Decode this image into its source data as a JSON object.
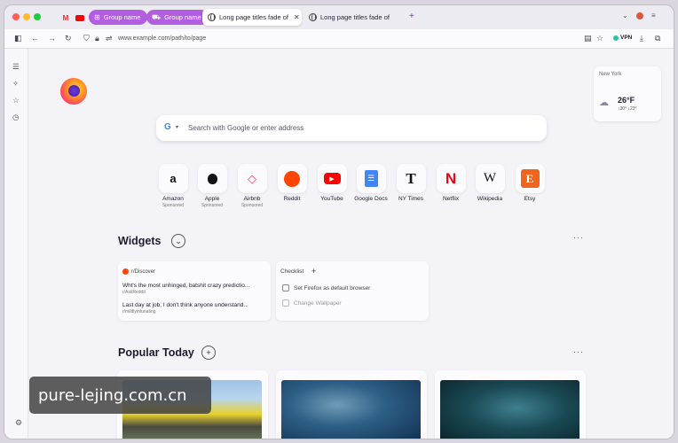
{
  "colors": {
    "group_chip": "#b25ee0",
    "traffic_red": "#ff5f57",
    "traffic_yellow": "#febc2e",
    "traffic_green": "#28c840"
  },
  "tabs": {
    "group1_label": "Group name",
    "group2_label": "Group name",
    "tab1_title": "Long page titles fade of",
    "tab2_title": "Long page titles fade of"
  },
  "navbar": {
    "url": "www.example.com/path/to/page",
    "vpn_label": "VPN"
  },
  "weather": {
    "city": "New York",
    "temp": "26°F",
    "range": "↑30° ↓23°"
  },
  "search": {
    "placeholder": "Search with Google or enter address"
  },
  "shortcuts": [
    {
      "label": "Amazon",
      "sub": "Sponsored",
      "glyph": "a"
    },
    {
      "label": "Apple",
      "sub": "Sponsored",
      "glyph": ""
    },
    {
      "label": "Airbnb",
      "sub": "Sponsored",
      "glyph": "◇"
    },
    {
      "label": "Reddit",
      "sub": "",
      "glyph": "●"
    },
    {
      "label": "YouTube",
      "sub": "",
      "glyph": "▶"
    },
    {
      "label": "Google Docs",
      "sub": "",
      "glyph": "☰"
    },
    {
      "label": "NY Times",
      "sub": "",
      "glyph": "T"
    },
    {
      "label": "Netflix",
      "sub": "",
      "glyph": "N"
    },
    {
      "label": "Wikipedia",
      "sub": "",
      "glyph": "W"
    },
    {
      "label": "Etsy",
      "sub": "",
      "glyph": "E"
    }
  ],
  "widgets": {
    "title": "Widgets",
    "discover": {
      "header": "r/Discover",
      "posts": [
        {
          "title": "Wht's the most unhinged, batshit crazy predictio...",
          "sub": "r/AskReddit"
        },
        {
          "title": "Last day at job, I don't think anyone understand...",
          "sub": "r/mildlyinfuriating"
        }
      ]
    },
    "checklist": {
      "header": "Checklist",
      "items": [
        "Set Firefox as default browser",
        "Change Wallpaper"
      ]
    }
  },
  "popular": {
    "title": "Popular Today"
  },
  "watermark": "pure-lejing.com.cn"
}
